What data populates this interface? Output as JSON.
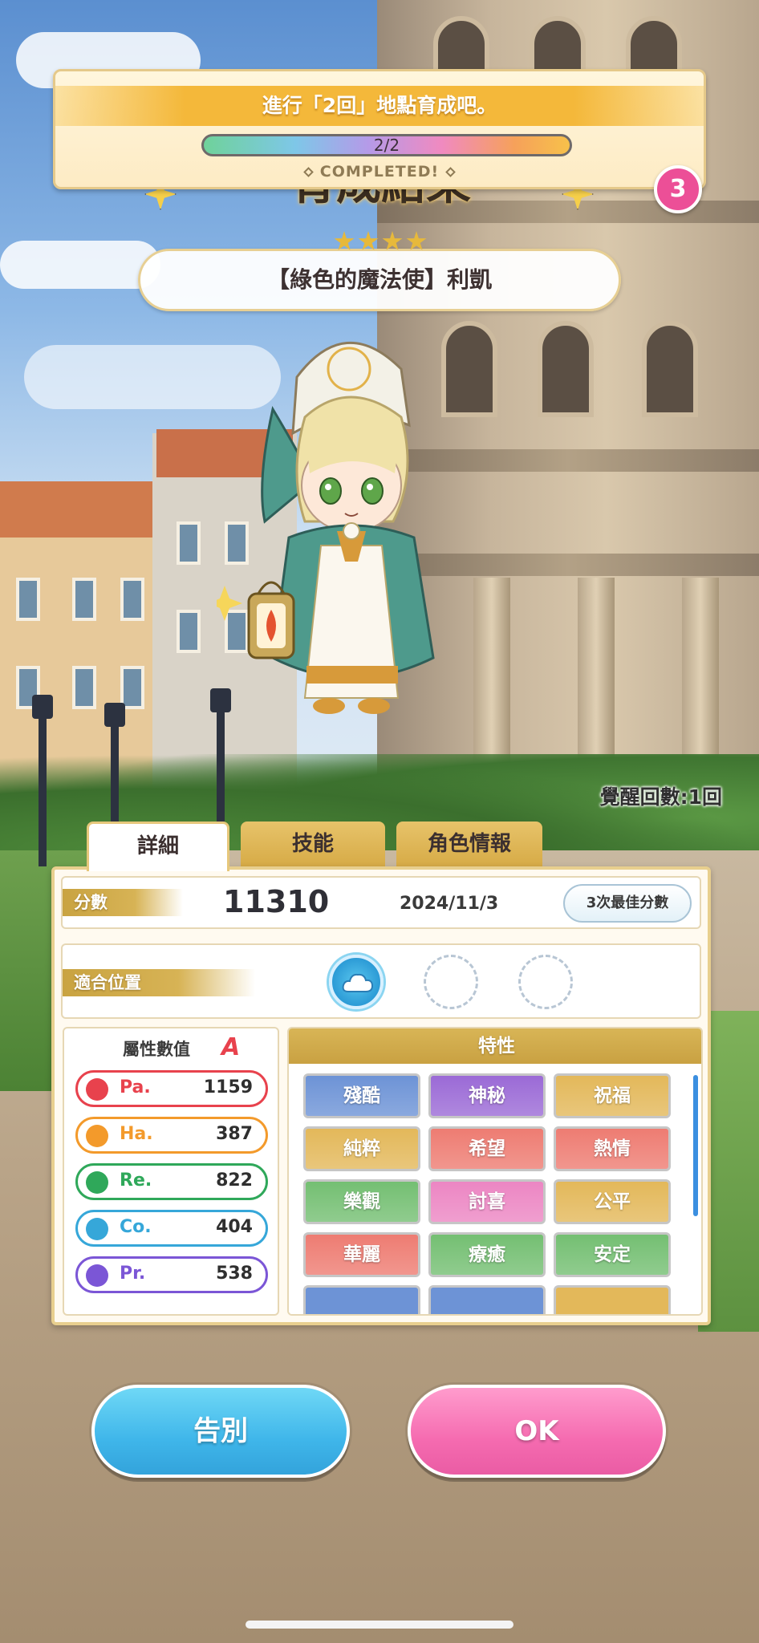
{
  "mission": {
    "title": "進行「2回」地點育成吧。",
    "progress_text": "2/2",
    "progress_fraction": 1.0,
    "completed": "COMPLETED!"
  },
  "badge": {
    "count": "3"
  },
  "result_header": {
    "title": "育成結果",
    "stars": 4
  },
  "card": {
    "name": "【綠色的魔法使】利凱"
  },
  "awaken": {
    "text": "覺醒回數:1回"
  },
  "tabs": [
    {
      "label": "詳細",
      "active": true
    },
    {
      "label": "技能",
      "active": false
    },
    {
      "label": "角色情報",
      "active": false
    }
  ],
  "score": {
    "label": "分數",
    "value": "11310",
    "date": "2024/11/3",
    "best_button": "3次最佳分數"
  },
  "position": {
    "label": "適合位置",
    "slots": [
      "filled",
      "empty",
      "empty"
    ]
  },
  "stats": {
    "title": "屬性數值",
    "rank": "A",
    "items": [
      {
        "name": "Pa.",
        "value": "1159",
        "color": "#e8424d",
        "icon": "fire-icon"
      },
      {
        "name": "Ha.",
        "value": "387",
        "color": "#f39a2b",
        "icon": "sun-icon"
      },
      {
        "name": "Re.",
        "value": "822",
        "color": "#2fa85a",
        "icon": "clover-icon"
      },
      {
        "name": "Co.",
        "value": "404",
        "color": "#36a7d9",
        "icon": "wave-icon"
      },
      {
        "name": "Pr.",
        "value": "538",
        "color": "#7b56d6",
        "icon": "gem-icon"
      }
    ]
  },
  "traits": {
    "title": "特性",
    "items": [
      {
        "label": "殘酷",
        "color": "#6d93d6"
      },
      {
        "label": "神秘",
        "color": "#9b6ad6"
      },
      {
        "label": "祝福",
        "color": "#e3b85a"
      },
      {
        "label": "純粹",
        "color": "#e3b85a"
      },
      {
        "label": "希望",
        "color": "#ee7c72"
      },
      {
        "label": "熱情",
        "color": "#ee7c72"
      },
      {
        "label": "樂觀",
        "color": "#74bf72"
      },
      {
        "label": "討喜",
        "color": "#ec86c3"
      },
      {
        "label": "公平",
        "color": "#e3b85a"
      },
      {
        "label": "華麗",
        "color": "#ee7c72"
      },
      {
        "label": "療癒",
        "color": "#74bf72"
      },
      {
        "label": "安定",
        "color": "#74bf72"
      }
    ]
  },
  "buttons": {
    "farewell": "告別",
    "ok": "OK"
  }
}
